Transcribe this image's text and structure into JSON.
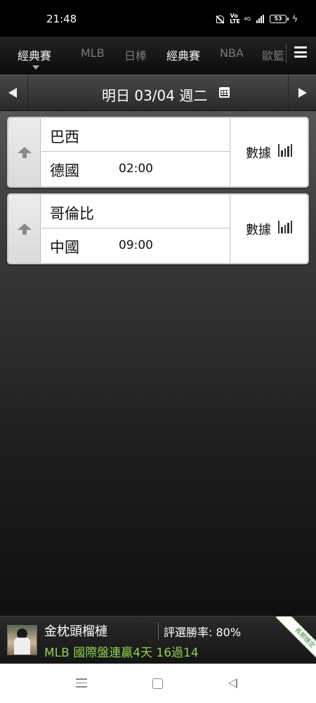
{
  "status_bar": {
    "time": "21:48",
    "network": "4G",
    "battery": "53"
  },
  "league_tabs": [
    {
      "label": "經典賽",
      "active": true
    },
    {
      "label": "MLB"
    },
    {
      "label": "日棒"
    },
    {
      "label": "經典賽"
    },
    {
      "label": "NBA"
    },
    {
      "label": "歐籃"
    }
  ],
  "date_bar": {
    "label": "明日 03/04 週二"
  },
  "games": [
    {
      "home": "巴西",
      "away": "德國",
      "time": "02:00",
      "stats_label": "數據"
    },
    {
      "home": "哥倫比",
      "away": "中國",
      "time": "09:00",
      "stats_label": "數據"
    }
  ],
  "expert_banner": {
    "name": "金枕頭榴槤",
    "win_rate": "評選勝率: 80%",
    "streak": "MLB 國際盤連贏4天 16過14",
    "ribbon": "長期穩定"
  },
  "colors": {
    "streak_green": "#8fd14f",
    "ribbon_green": "#3a8a2c"
  }
}
